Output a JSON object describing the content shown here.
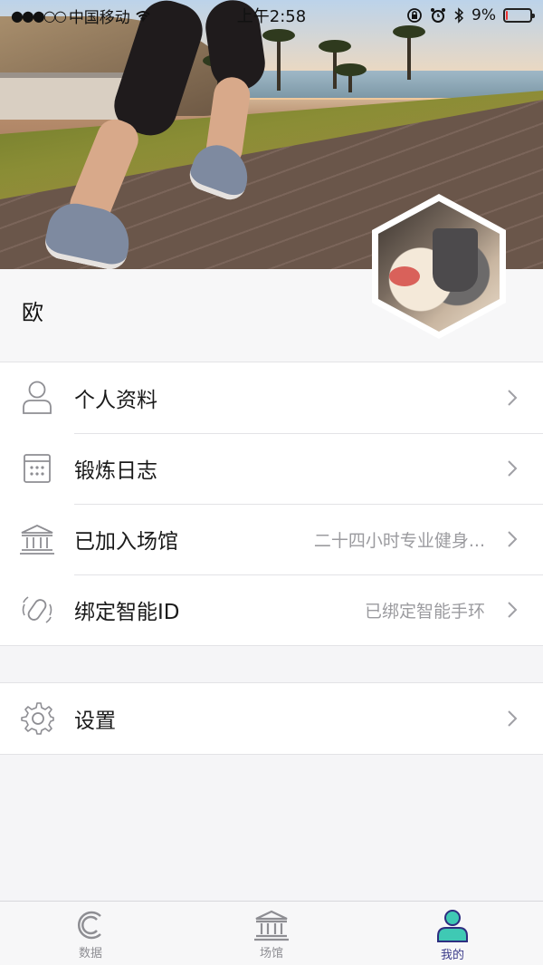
{
  "statusbar": {
    "carrier": "中国移动",
    "time": "上午2:58",
    "battery_percent": "9%",
    "battery_level": 0.09
  },
  "profile": {
    "name": "欧"
  },
  "menu_primary": [
    {
      "label": "个人资料",
      "value": "",
      "icon": "person-icon"
    },
    {
      "label": "锻炼日志",
      "value": "",
      "icon": "calendar-icon"
    },
    {
      "label": "已加入场馆",
      "value": "二十四小时专业健身...",
      "icon": "gym-building-icon"
    },
    {
      "label": "绑定智能ID",
      "value": "已绑定智能手环",
      "icon": "smart-band-icon"
    }
  ],
  "menu_secondary": [
    {
      "label": "设置",
      "value": "",
      "icon": "gear-icon"
    }
  ],
  "tabbar": {
    "tabs": [
      {
        "label": "数据",
        "icon": "data-c-icon",
        "active": false
      },
      {
        "label": "场馆",
        "icon": "gym-building-icon",
        "active": false
      },
      {
        "label": "我的",
        "icon": "person-filled-icon",
        "active": true
      }
    ],
    "active_color": "#3a3a8a",
    "active_icon_color": "#3fc9b4"
  }
}
